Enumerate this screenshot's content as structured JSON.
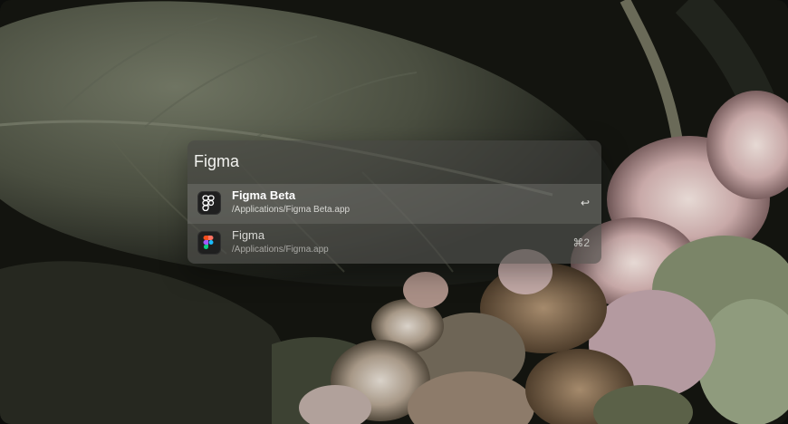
{
  "launcher": {
    "query": "Figma",
    "results": [
      {
        "name": "Figma Beta",
        "path": "/Applications/Figma Beta.app",
        "shortcut": "↩",
        "icon": "figma-beta-icon"
      },
      {
        "name": "Figma",
        "path": "/Applications/Figma.app",
        "shortcut": "⌘2",
        "icon": "figma-icon"
      }
    ]
  },
  "colors": {
    "panel": "#46463f",
    "selected_row": "#787874",
    "text_primary": "#ffffff",
    "text_secondary": "#d8d8d4"
  }
}
